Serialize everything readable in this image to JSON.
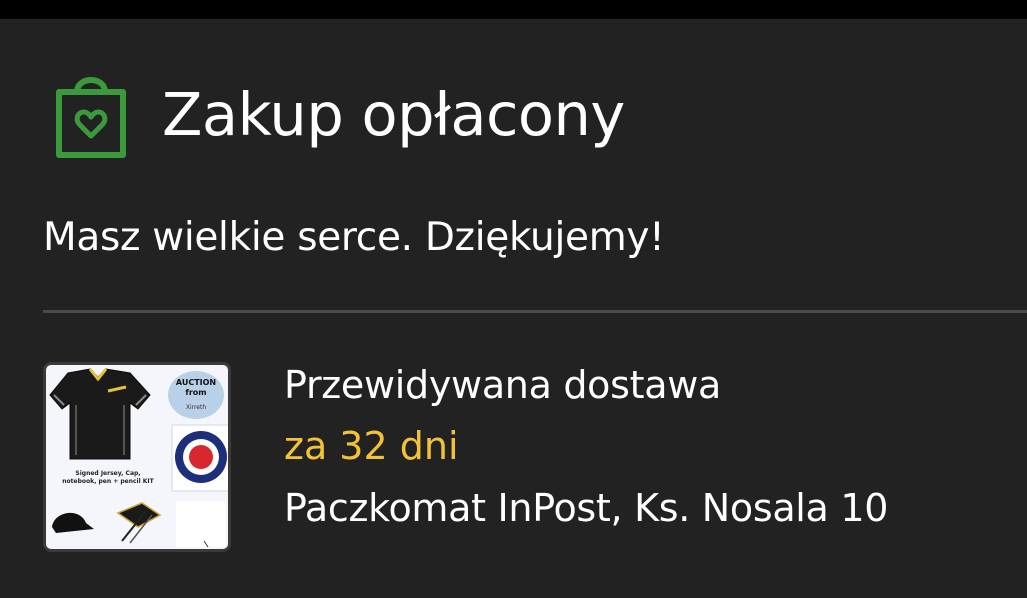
{
  "status": {
    "title": "Zakup opłacony",
    "message": "Masz wielkie serce. Dziękujemy!",
    "icon": "shopping-bag-heart-icon",
    "accent_color": "#3b9b3c"
  },
  "delivery": {
    "label": "Przewidywana dostawa",
    "eta": "za 32 dni",
    "eta_color": "#f4c335",
    "location": "Paczkomat InPost, Ks. Nosala 10"
  },
  "product_image": {
    "badge_line1": "AUCTION",
    "badge_line2": "from",
    "badge_line3": "Xirreth",
    "caption_line1": "Signed Jersey, Cap,",
    "caption_line2": "notebook, pen + pencil KIT"
  }
}
